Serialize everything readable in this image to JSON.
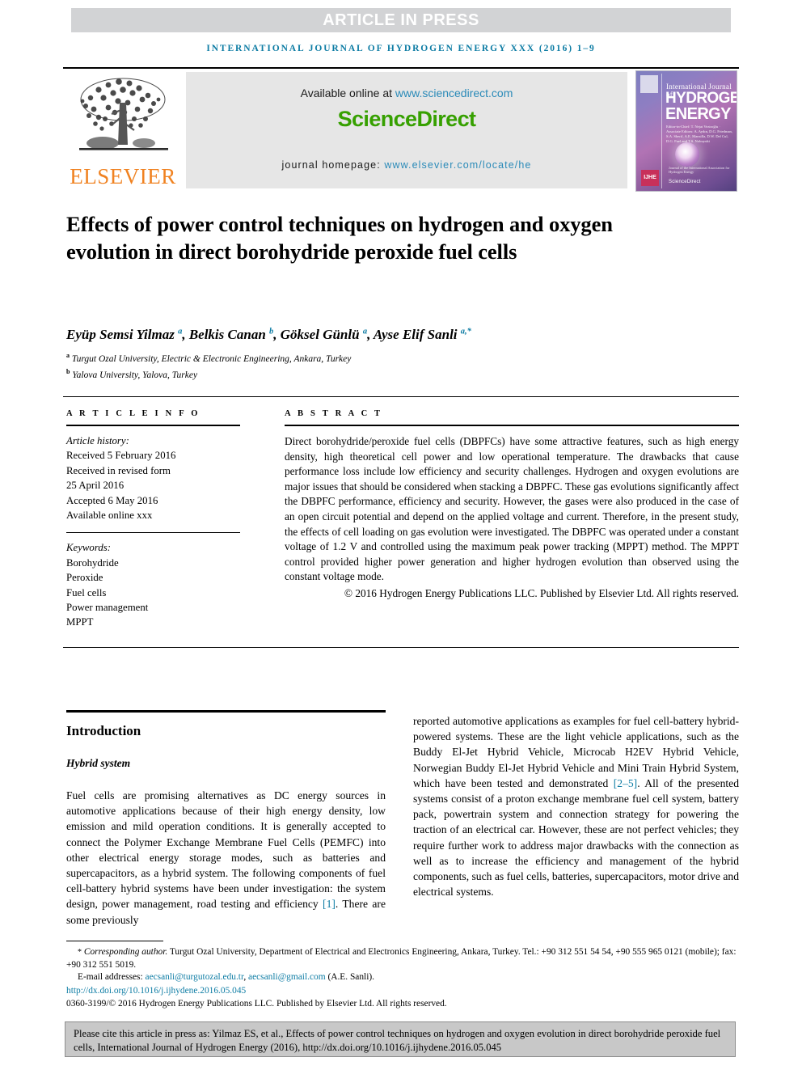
{
  "header": {
    "article_in_press": "ARTICLE IN PRESS",
    "running_head": "INTERNATIONAL JOURNAL OF HYDROGEN ENERGY XXX (2016) 1–9"
  },
  "masthead": {
    "publisher_name": "ELSEVIER",
    "available_prefix": "Available online at ",
    "available_url": "www.sciencedirect.com",
    "sciencedirect_logo": "ScienceDirect",
    "homepage_prefix": "journal homepage: ",
    "homepage_url": "www.elsevier.com/locate/he",
    "cover": {
      "line1": "International Journal of",
      "line2": "HYDROGEN",
      "line3": "ENERGY",
      "editors": "Editor-in-Chief: T. Nejat Veziroğlu  ·  Associate Editors: A. Aydın, D.G. Friedman, S.A. Sherif, A.E. Mansilla, D.W. Del Cul, D.G. Fuel and T.S. Nobuyuki",
      "footer_top": "Journal of the International Association for Hydrogen Energy",
      "footer_brand": "ScienceDirect",
      "badge": "IJHE"
    }
  },
  "article": {
    "title": "Effects of power control techniques on hydrogen and oxygen evolution in direct borohydride peroxide fuel cells",
    "authors_html": "Eyüp Semsi Yilmaz <sup>a</sup>, Belkis Canan <sup>b</sup>, Göksel Günlü <sup>a</sup>, Ayse Elif Sanli <sup>a,*</sup>",
    "affiliation_a": "Turgut Ozal University, Electric & Electronic Engineering, Ankara, Turkey",
    "affiliation_b": "Yalova University, Yalova, Turkey"
  },
  "article_info": {
    "heading": "A R T I C L E    I N F O",
    "history_label": "Article history:",
    "history": [
      "Received 5 February 2016",
      "Received in revised form",
      "25 April 2016",
      "Accepted 6 May 2016",
      "Available online xxx"
    ],
    "keywords_label": "Keywords:",
    "keywords": [
      "Borohydride",
      "Peroxide",
      "Fuel cells",
      "Power management",
      "MPPT"
    ]
  },
  "abstract": {
    "heading": "A B S T R A C T",
    "text": "Direct borohydride/peroxide fuel cells (DBPFCs) have some attractive features, such as high energy density, high theoretical cell power and low operational temperature. The drawbacks that cause performance loss include low efficiency and security challenges. Hydrogen and oxygen evolutions are major issues that should be considered when stacking a DBPFC. These gas evolutions significantly affect the DBPFC performance, efficiency and security. However, the gases were also produced in the case of an open circuit potential and depend on the applied voltage and current. Therefore, in the present study, the effects of cell loading on gas evolution were investigated. The DBPFC was operated under a constant voltage of 1.2 V and controlled using the maximum peak power tracking (MPPT) method. The MPPT control provided higher power generation and higher hydrogen evolution than observed using the constant voltage mode.",
    "copyright": "© 2016 Hydrogen Energy Publications LLC. Published by Elsevier Ltd. All rights reserved."
  },
  "body": {
    "section_heading": "Introduction",
    "subsection_heading": "Hybrid system",
    "left_paragraph_pre_ref": "Fuel cells are promising alternatives as DC energy sources in automotive applications because of their high energy density, low emission and mild operation conditions. It is generally accepted to connect the Polymer Exchange Membrane Fuel Cells (PEMFC) into other electrical energy storage modes, such as batteries and supercapacitors, as a hybrid system. The following components of fuel cell-battery hybrid systems have been under investigation: the system design, power management, road testing and efficiency ",
    "left_ref": "[1]",
    "left_paragraph_post_ref": ". There are some previously",
    "right_paragraph_pre_ref": "reported automotive applications as examples for fuel cell-battery hybrid-powered systems. These are the light vehicle applications, such as the Buddy El-Jet Hybrid Vehicle, Microcab H2EV Hybrid Vehicle, Norwegian Buddy El-Jet Hybrid Vehicle and Mini Train Hybrid System, which have been tested and demonstrated ",
    "right_ref": "[2–5]",
    "right_paragraph_post_ref": ". All of the presented systems consist of a proton exchange membrane fuel cell system, battery pack, powertrain system and connection strategy for powering the traction of an electrical car. However, these are not perfect vehicles; they require further work to address major drawbacks with the connection as well as to increase the efficiency and management of the hybrid components, such as fuel cells, batteries, supercapacitors, motor drive and electrical systems."
  },
  "footnotes": {
    "corresponding_star": "*",
    "corresponding_label": "Corresponding author.",
    "corresponding_text": " Turgut Ozal University, Department of Electrical and Electronics Engineering, Ankara, Turkey. Tel.: +90 312 551 54 54, +90 555 965 0121 (mobile); fax: +90 312 551 5019.",
    "email_label": "E-mail addresses: ",
    "email_1": "aecsanli@turgutozal.edu.tr",
    "email_sep": ", ",
    "email_2": "aecsanli@gmail.com",
    "email_suffix": " (A.E. Sanli).",
    "doi": "http://dx.doi.org/10.1016/j.ijhydene.2016.05.045",
    "issn_line": "0360-3199/© 2016 Hydrogen Energy Publications LLC. Published by Elsevier Ltd. All rights reserved."
  },
  "cite_box": {
    "text": "Please cite this article in press as: Yilmaz ES, et al., Effects of power control techniques on hydrogen and oxygen evolution in direct borohydride peroxide fuel cells, International Journal of Hydrogen Energy (2016), http://dx.doi.org/10.1016/j.ijhydene.2016.05.045"
  },
  "colors": {
    "accent_blue": "#0d7ca4",
    "elsevier_orange": "#f08221",
    "sciencedirect_green": "#36a000",
    "press_bar_gray": "#d2d3d5",
    "cite_box_gray": "#c8c8c8"
  }
}
